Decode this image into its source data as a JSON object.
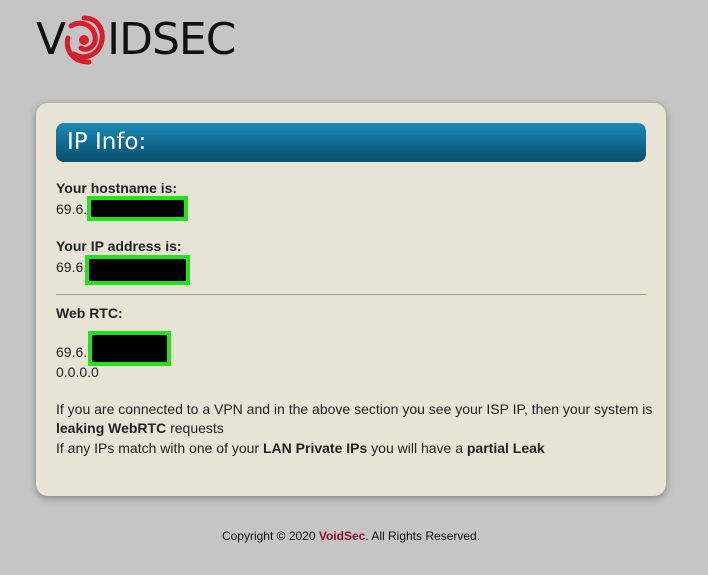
{
  "logo": {
    "text_left": "V",
    "text_right": "IDSEC"
  },
  "panel": {
    "title": "IP Info:",
    "hostname_label": "Your hostname is:",
    "hostname_value": "69.6.",
    "ip_label": "Your IP address is:",
    "ip_value": "69.6.",
    "webrtc_label": "Web RTC:",
    "webrtc_values": [
      "69.6.",
      "0.0.0.0"
    ],
    "note1_a": "If you are connected to a VPN and in the above section you see your ISP IP, then your system is ",
    "note1_b": "leaking WebRTC",
    "note1_c": " requests",
    "note2_a": "If any IPs match with one of your ",
    "note2_b": "LAN Private IPs",
    "note2_c": " you will have a ",
    "note2_d": "partial Leak"
  },
  "footer": {
    "prefix": "Copyright © 2020 ",
    "brand": "VoidSec",
    "suffix": ". All Rights Reserved."
  },
  "colors": {
    "background": "#c5c5c5",
    "card": "#e7e4d6",
    "header_bar": "#0d5f82",
    "redaction_border": "#21e21b",
    "brand": "#8b0d34"
  }
}
